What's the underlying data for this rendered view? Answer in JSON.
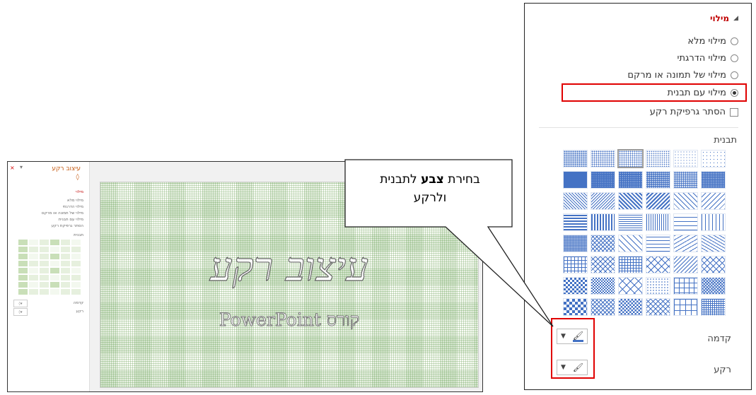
{
  "fill_pane": {
    "section_title": "מילוי",
    "options": [
      {
        "label": "מילוי מלא",
        "selected": false
      },
      {
        "label": "מילוי הדרגתי",
        "selected": false
      },
      {
        "label": "מילוי של תמונה או מרקם",
        "selected": false
      },
      {
        "label": "מילוי עם תבנית",
        "selected": true
      }
    ],
    "hide_background_graphics": "הסתר גרפיקת רקע",
    "pattern_label": "תבנית",
    "foreground_label": "קדמה",
    "background_label": "רקע",
    "pattern_color": "#4472c4"
  },
  "callout": {
    "prefix": "בחירת",
    "bold": "צבע",
    "suffix": "לתבנית",
    "line2": "ולרקע"
  },
  "slide_window": {
    "pane_title": "עיצוב רקע",
    "close": "×",
    "mini_section": "מילוי",
    "mini_options": [
      "מילוי מלא",
      "מילוי הדרגתי",
      "מילוי של תמונה או מרקם",
      "מילוי עם תבנית",
      "הסתר גרפיקת רקע"
    ],
    "mini_pattern_label": "תבנית",
    "mini_foreground": "קדמה",
    "mini_background": "רקע",
    "slide_title": "עיצוב רקע",
    "slide_subtitle": "קורס PowerPoint",
    "pattern_color": "#70ad47"
  }
}
